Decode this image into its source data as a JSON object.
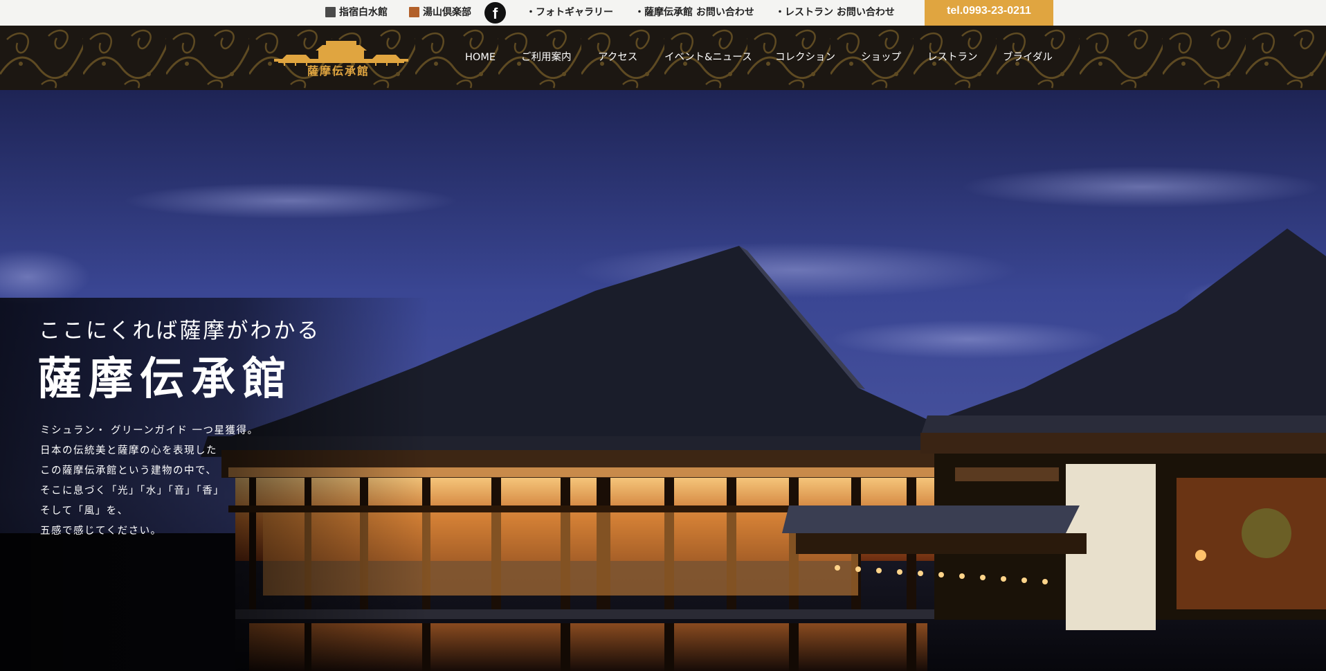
{
  "topbar": {
    "ibusuki": "指宿白水館",
    "yuyama": "湯山倶楽部",
    "facebook_glyph": "f",
    "links": [
      "・フォトギャラリー",
      "・薩摩伝承館 お問い合わせ",
      "・レストラン お問い合わせ"
    ],
    "tel": "tel.0993-23-0211"
  },
  "header": {
    "logo_text": "薩摩伝承館",
    "nav": [
      "HOME",
      "ご利用案内",
      "アクセス",
      "イベント&ニュース",
      "コレクション",
      "ショップ",
      "レストラン",
      "ブライダル"
    ]
  },
  "hero": {
    "tagline": "ここにくれば薩摩がわかる",
    "title": "薩摩伝承館",
    "description": [
      "ミシュラン・ グリーンガイド 一つ星獲得。",
      "日本の伝統美と薩摩の心を表現した",
      "この薩摩伝承館という建物の中で、",
      "そこに息づく「光」「水」「音」「香」",
      "そして「風」を、",
      "五感で感じてください。"
    ]
  },
  "colors": {
    "accent_gold": "#e0a540",
    "header_bg": "#1c1712",
    "topbar_bg": "#f4f4f2"
  },
  "icons": {
    "facebook": "facebook-icon",
    "ibusuki": "ibusuki-logo-icon",
    "yuyama": "yuyama-logo-icon"
  }
}
